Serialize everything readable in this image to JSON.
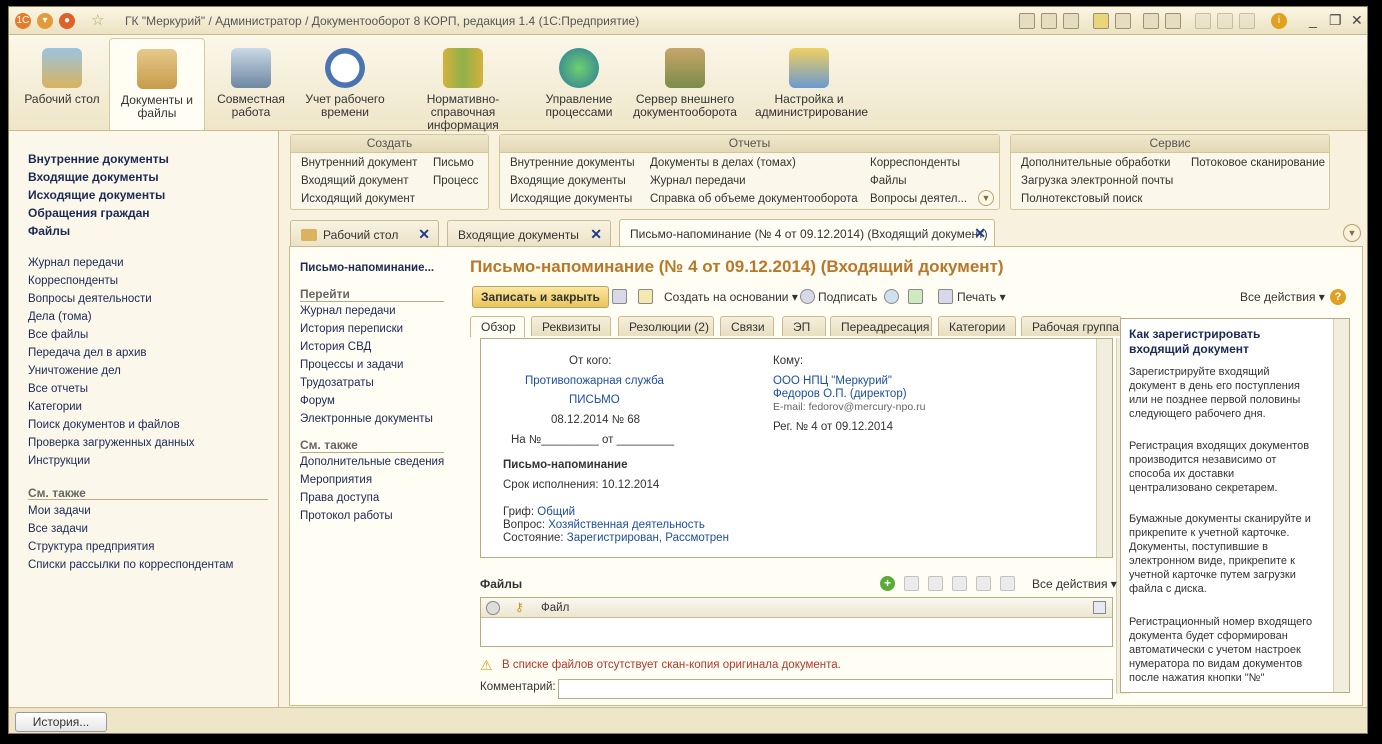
{
  "window": {
    "title": "ГК \"Меркурий\" / Администратор / Документооборот 8 КОРП, редакция 1.4  (1С:Предприятие)"
  },
  "sections": [
    {
      "label": "Рабочий стол",
      "icon": "desk-lamp-icon"
    },
    {
      "label": "Документы и файлы",
      "icon": "folder-icon"
    },
    {
      "label": "Совместная работа",
      "icon": "people-icon"
    },
    {
      "label": "Учет рабочего времени",
      "icon": "clock-icon"
    },
    {
      "label": "Нормативно-справочная информация",
      "icon": "binders-icon"
    },
    {
      "label": "Управление процессами",
      "icon": "process-icon"
    },
    {
      "label": "Сервер внешнего документооборота",
      "icon": "server-icon"
    },
    {
      "label": "Настройка и администрирование",
      "icon": "database-icon"
    }
  ],
  "left": {
    "bold": [
      "Внутренние документы",
      "Входящие документы",
      "Исходящие документы",
      "Обращения граждан",
      "Файлы"
    ],
    "links": [
      "Журнал передачи",
      "Корреспонденты",
      "Вопросы деятельности",
      "Дела (тома)",
      "Все файлы",
      "Передача дел в архив",
      "Уничтожение дел",
      "Все отчеты",
      "Категории",
      "Поиск документов и файлов",
      "Проверка загруженных данных",
      "Инструкции"
    ],
    "see_also_header": "См. также",
    "see_also": [
      "Мои задачи",
      "Все задачи",
      "Структура предприятия",
      "Списки рассылки по корреспондентам"
    ]
  },
  "groups": {
    "create": {
      "title": "Создать",
      "items": [
        "Внутренний документ",
        "Входящий документ",
        "Исходящий документ",
        "Письмо",
        "Процесс"
      ]
    },
    "reports": {
      "title": "Отчеты",
      "items": [
        "Внутренние документы",
        "Входящие документы",
        "Исходящие документы",
        "Документы в делах (томах)",
        "Журнал передачи",
        "Справка об объеме документооборота",
        "Корреспонденты",
        "Файлы",
        "Вопросы деятел..."
      ]
    },
    "service": {
      "title": "Сервис",
      "items": [
        "Дополнительные обработки",
        "Загрузка электронной почты",
        "Полнотекстовый поиск",
        "Потоковое сканирование"
      ]
    }
  },
  "tabs": [
    "Рабочий стол",
    "Входящие документы",
    "Письмо-напоминание (№ 4 от 09.12.2014) (Входящий документ)"
  ],
  "sub": {
    "title": "Письмо-напоминание...",
    "go_header": "Перейти",
    "go": [
      "Журнал передачи",
      "История переписки",
      "История СВД",
      "Процессы и задачи",
      "Трудозатраты",
      "Форум",
      "Электронные документы"
    ],
    "see_header": "См. также",
    "see": [
      "Дополнительные сведения",
      "Мероприятия",
      "Права доступа",
      "Протокол работы"
    ]
  },
  "doc": {
    "title": "Письмо-напоминание (№ 4 от 09.12.2014) (Входящий документ)",
    "save_close": "Записать и закрыть",
    "create_based": "Создать на основании",
    "sign": "Подписать",
    "print": "Печать",
    "all_actions": "Все действия",
    "tabs": [
      "Обзор",
      "Реквизиты",
      "Резолюции (2)",
      "Связи",
      "ЭП",
      "Переадресация",
      "Категории",
      "Рабочая группа"
    ],
    "card": {
      "from_label": "От кого:",
      "from_org": "Противопожарная служба",
      "from_type": "ПИСЬМО",
      "from_date": "08.12.2014 № 68",
      "ref_line": "На №_________ от _________",
      "to_label": "Кому:",
      "to_org": "ООО НПЦ \"Меркурий\"",
      "to_person": "Федоров О.П. (директор)",
      "to_email": "E-mail: fedorov@mercury-npo.ru",
      "reg": "Рег. № 4 от 09.12.2014",
      "doc_title": "Письмо-напоминание",
      "deadline": "Срок исполнения: 10.12.2014",
      "grif_label": "Гриф:",
      "grif": "Общий",
      "question_label": "Вопрос:",
      "question": "Хозяйственная деятельность",
      "state_label": "Состояние:",
      "state": "Зарегистрирован, Рассмотрен"
    },
    "files_title": "Файлы",
    "files_all_actions": "Все действия",
    "file_col": "Файл",
    "warning": "В списке файлов отсутствует скан-копия оригинала документа.",
    "comment_label": "Комментарий:"
  },
  "help": {
    "title": "Как зарегистрировать входящий документ",
    "paragraphs": [
      "Зарегистрируйте входящий документ в день его поступления или не позднее первой половины следующего рабочего дня.",
      "Регистрация входящих документов производится независимо от способа их доставки централизовано секретарем.",
      "Бумажные документы сканируйте и прикрепите к учетной карточке. Документы, поступившие в электронном виде, прикрепите к учетной карточке путем загрузки файла с диска.",
      "Регистрационный номер входящего документа будет сформирован автоматически с учетом настроек нумератора по видам документов после нажатия кнопки \"№\""
    ]
  },
  "status": {
    "history": "История..."
  }
}
